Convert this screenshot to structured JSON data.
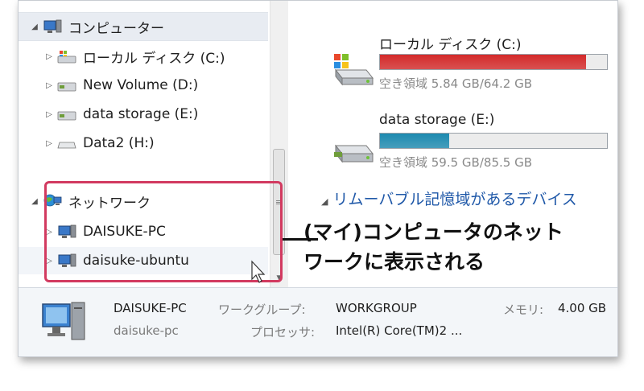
{
  "nav": {
    "computer": {
      "label": "コンピューター",
      "icon": "computer-icon"
    },
    "drives": [
      {
        "label": "ローカル ディスク (C:)",
        "icon": "windows-drive-icon"
      },
      {
        "label": "New Volume (D:)",
        "icon": "hard-drive-icon"
      },
      {
        "label": "data storage (E:)",
        "icon": "hard-drive-icon"
      },
      {
        "label": "Data2 (H:)",
        "icon": "removable-drive-icon"
      }
    ],
    "network": {
      "label": "ネットワーク",
      "icon": "network-globe-icon"
    },
    "network_items": [
      {
        "label": "DAISUKE-PC",
        "icon": "computer-icon"
      },
      {
        "label": "daisuke-ubuntu",
        "icon": "computer-icon"
      }
    ]
  },
  "content": {
    "drives": [
      {
        "name": "ローカル ディスク (C:)",
        "space": "空き領域 5.84 GB/64.2 GB",
        "used_fraction": 0.909,
        "bar_color": "#d42a2a",
        "icon": "windows-drive-icon"
      },
      {
        "name": "data storage (E:)",
        "space": "空き領域 59.5 GB/85.5 GB",
        "used_fraction": 0.304,
        "bar_color": "#1d8ab0",
        "icon": "hard-drive-icon"
      }
    ],
    "section_removable": "リムーバブル記憶域があるデバイス"
  },
  "details": {
    "name": "DAISUKE-PC",
    "sub": "daisuke-pc",
    "workgroup_label": "ワークグループ:",
    "workgroup_value": "WORKGROUP",
    "processor_label": "プロセッサ:",
    "processor_value": "Intel(R) Core(TM)2 ...",
    "memory_label": "メモリ:",
    "memory_value": "4.00 GB"
  },
  "annotation": {
    "line1": "(マイ)コンピュータのネット",
    "line2": "ワークに表示される",
    "color": "#d23a60"
  }
}
